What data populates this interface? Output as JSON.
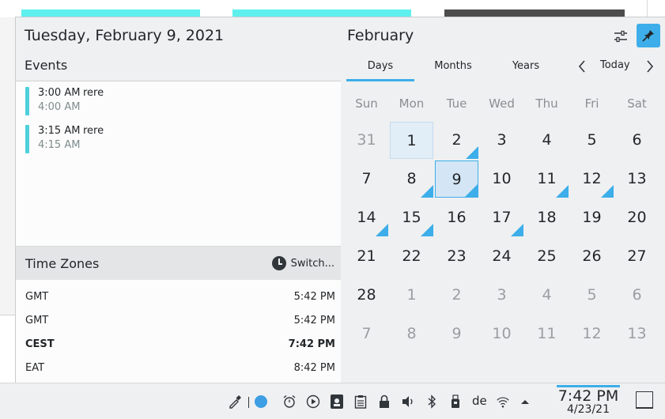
{
  "left": {
    "date_header": "Tuesday, February 9, 2021",
    "events_header": "Events",
    "events": [
      {
        "start": "3:00 AM",
        "end": "4:00 AM",
        "title": "rere"
      },
      {
        "start": "3:15 AM",
        "end": "4:15 AM",
        "title": "rere"
      }
    ],
    "timezones_header": "Time Zones",
    "switch_label": "Switch...",
    "timezones": [
      {
        "name": "GMT",
        "time": "5:42 PM"
      },
      {
        "name": "GMT",
        "time": "5:42 PM"
      },
      {
        "name": "CEST",
        "time": "7:42 PM"
      },
      {
        "name": "EAT",
        "time": "8:42 PM"
      }
    ]
  },
  "calendar": {
    "month_title": "February",
    "tabs": [
      "Days",
      "Months",
      "Years"
    ],
    "today_label": "Today",
    "weekdays": [
      "Sun",
      "Mon",
      "Tue",
      "Wed",
      "Thu",
      "Fri",
      "Sat"
    ],
    "days": [
      "31",
      "1",
      "2",
      "3",
      "4",
      "5",
      "6",
      "7",
      "8",
      "9",
      "10",
      "11",
      "12",
      "13",
      "14",
      "15",
      "16",
      "17",
      "18",
      "19",
      "20",
      "21",
      "22",
      "23",
      "24",
      "25",
      "26",
      "27",
      "28",
      "1",
      "2",
      "3",
      "4",
      "5",
      "6",
      "7",
      "8",
      "9",
      "10",
      "11",
      "12",
      "13"
    ]
  },
  "panel": {
    "keyboard_layout": "de",
    "time": "7:42 PM",
    "date": "4/23/21"
  },
  "colors": {
    "accent": "#3daee9",
    "event_stripe": "#4dd0d9",
    "today_bg": "#e1edf7"
  }
}
